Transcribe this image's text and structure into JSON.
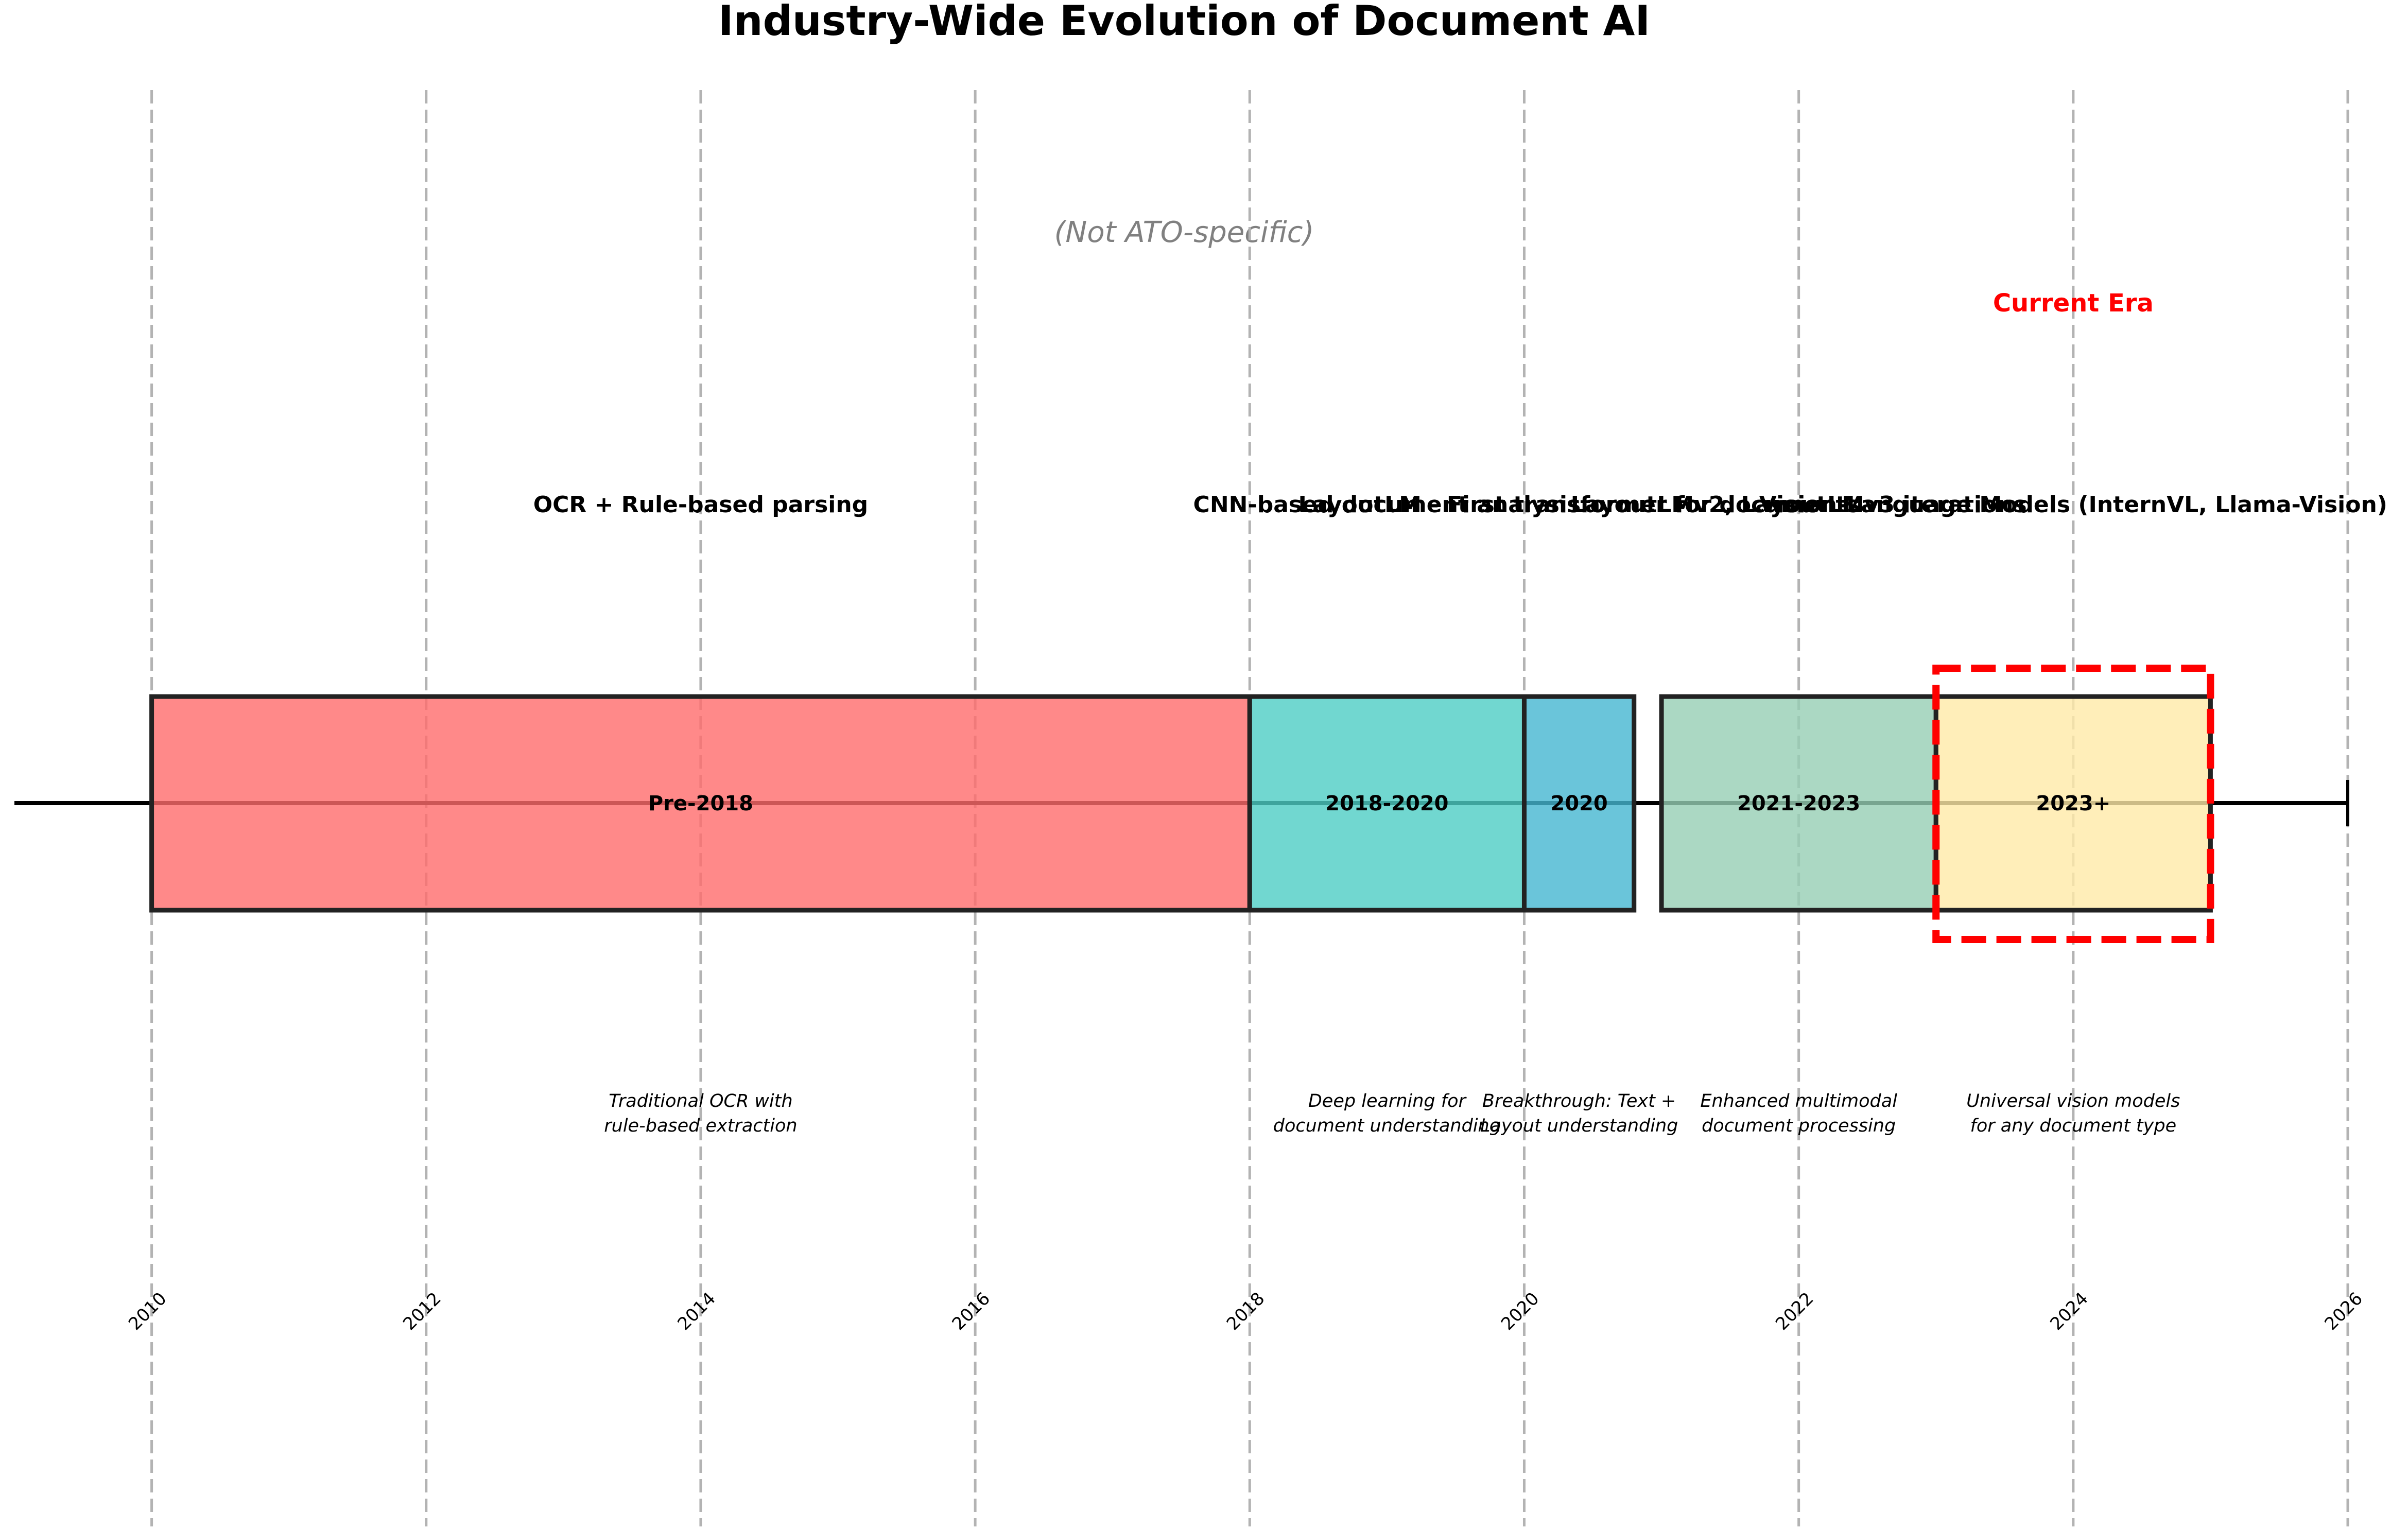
{
  "chart_data": {
    "type": "timeline",
    "title": "Industry-Wide Evolution of Document AI",
    "subtitle": "(Not ATO-specific)",
    "xlim": [
      2009,
      2026
    ],
    "ticks": [
      2010,
      2012,
      2014,
      2016,
      2018,
      2020,
      2022,
      2024,
      2026
    ],
    "grid": true,
    "eras": [
      {
        "label": "Pre-2018",
        "start": 2010,
        "end": 2018,
        "technology": "OCR + Rule-based parsing",
        "description": [
          "Traditional OCR with",
          "rule-based extraction"
        ],
        "color": "#FF6B6B"
      },
      {
        "label": "2018-2020",
        "start": 2018,
        "end": 2020,
        "technology": "CNN-based document analysis",
        "description": [
          "Deep learning for",
          "document understanding"
        ],
        "color": "#4ECDC4"
      },
      {
        "label": "2020",
        "start": 2020,
        "end": 2020.8,
        "technology": "LayoutLM - First transformer for documents",
        "description": [
          "Breakthrough: Text +",
          "Layout understanding"
        ],
        "color": "#45B7D1"
      },
      {
        "label": "2021-2023",
        "start": 2021,
        "end": 2023,
        "technology": "LayoutLMv2, LayoutLMv3 iterations",
        "description": [
          "Enhanced multimodal",
          "document processing"
        ],
        "color": "#96CEB4"
      },
      {
        "label": "2023+",
        "start": 2023,
        "end": 2025,
        "technology": "Vision-Language Models (InternVL, Llama-Vision)",
        "description": [
          "Universal vision models",
          "for any document type"
        ],
        "color": "#FFEAA7"
      }
    ],
    "highlight": {
      "label": "Current Era",
      "start": 2023,
      "end": 2025,
      "color": "#FF0000"
    }
  }
}
